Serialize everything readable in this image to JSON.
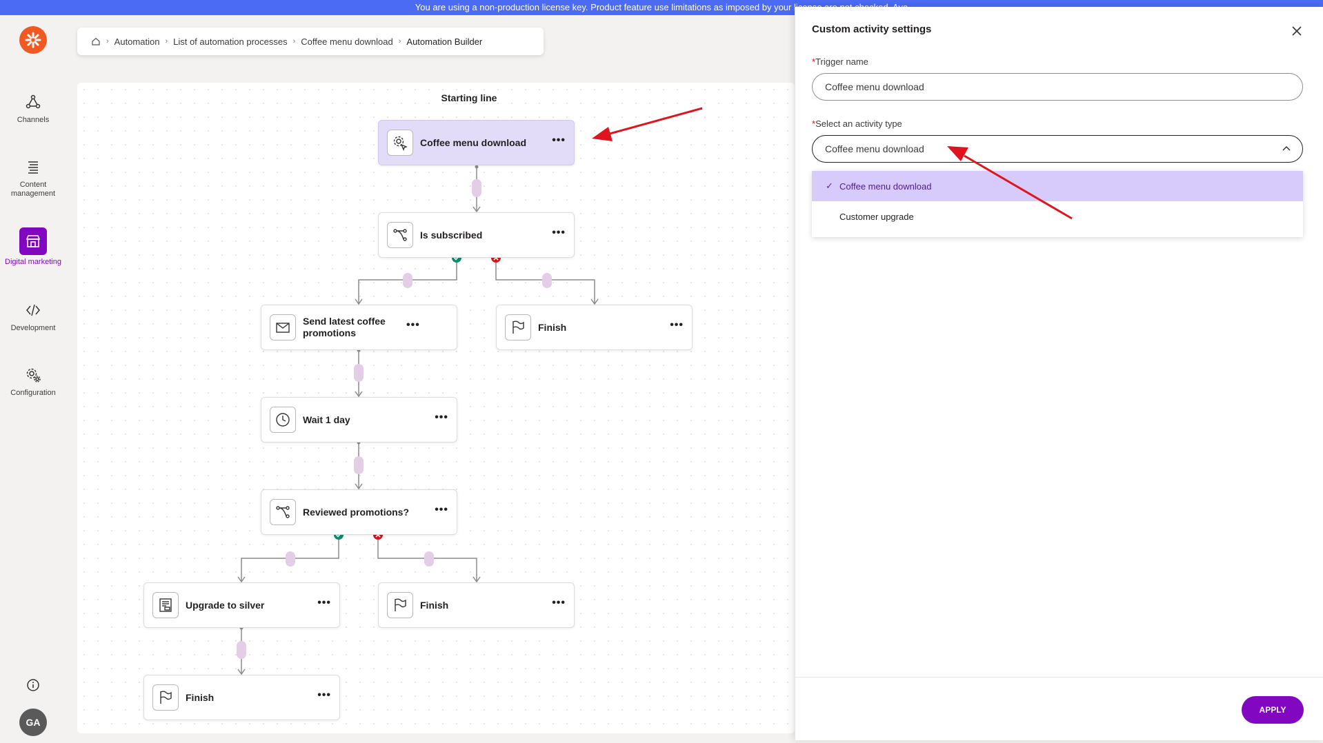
{
  "banner": {
    "text": "You are using a non-production license key. Product feature use limitations as imposed by your license are not checked. Ava"
  },
  "nav": {
    "items": [
      {
        "label": "Channels",
        "icon": "channels-icon"
      },
      {
        "label": "Content management",
        "icon": "content-icon"
      },
      {
        "label": "Digital marketing",
        "icon": "store-icon",
        "active": true
      },
      {
        "label": "Development",
        "icon": "code-icon"
      },
      {
        "label": "Configuration",
        "icon": "gear-icon"
      }
    ],
    "avatar": "GA"
  },
  "breadcrumb": {
    "items": [
      "Automation",
      "List of automation processes",
      "Coffee menu download"
    ],
    "current": "Automation Builder"
  },
  "canvas": {
    "start_label": "Starting line",
    "nodes": [
      {
        "label": "Coffee menu download",
        "icon": "trigger-icon"
      },
      {
        "label": "Is subscribed",
        "icon": "condition-icon"
      },
      {
        "label": "Send latest coffee promotions",
        "icon": "email-icon"
      },
      {
        "label": "Finish",
        "icon": "flag-icon"
      },
      {
        "label": "Wait 1 day",
        "icon": "clock-icon"
      },
      {
        "label": "Reviewed promotions?",
        "icon": "condition-icon"
      },
      {
        "label": "Upgrade to silver",
        "icon": "contact-icon"
      },
      {
        "label": "Finish",
        "icon": "flag-icon"
      },
      {
        "label": "Finish",
        "icon": "flag-icon"
      }
    ],
    "more": "•••"
  },
  "panel": {
    "title": "Custom activity settings",
    "trigger_name_label": "Trigger name",
    "trigger_name_value": "Coffee menu download",
    "activity_type_label": "Select an activity type",
    "activity_type_value": "Coffee menu download",
    "options": [
      "Coffee menu download",
      "Customer upgrade"
    ],
    "selected_option": "Coffee menu download",
    "apply_label": "APPLY"
  },
  "colors": {
    "accent": "#8107c1",
    "banner": "#4b6bf5",
    "arrow": "#e0141e",
    "yes": "#0f8a6d",
    "no": "#d4141b"
  }
}
